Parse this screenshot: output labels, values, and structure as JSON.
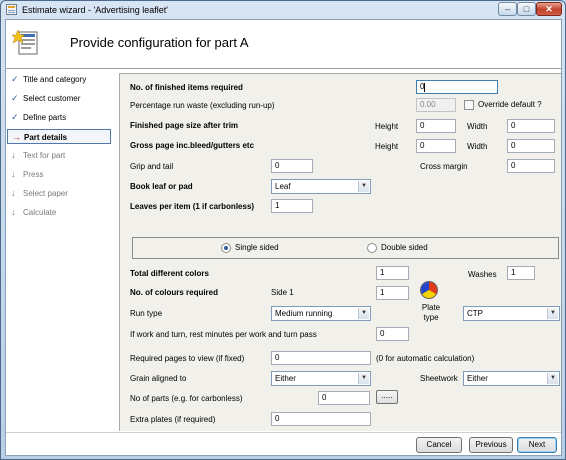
{
  "window": {
    "title": "Estimate wizard - 'Advertising leaflet'"
  },
  "titlebar": {
    "minimize": "–",
    "maximize": "□",
    "close": "✕"
  },
  "header": {
    "title": "Provide configuration for part A"
  },
  "steps": [
    {
      "label": "Title and category",
      "mark": "✓",
      "state": "done"
    },
    {
      "label": "Select customer",
      "mark": "✓",
      "state": "done"
    },
    {
      "label": "Define parts",
      "mark": "✓",
      "state": "done"
    },
    {
      "label": "Part details",
      "mark": "→",
      "state": "current"
    },
    {
      "label": "Text for part",
      "mark": "↓",
      "state": "pending"
    },
    {
      "label": "Press",
      "mark": "↓",
      "state": "pending"
    },
    {
      "label": "Select paper",
      "mark": "↓",
      "state": "pending"
    },
    {
      "label": "Calculate",
      "mark": "↓",
      "state": "pending"
    }
  ],
  "form": {
    "finished_items": {
      "label": "No. of finished items required",
      "value": "0"
    },
    "run_waste": {
      "label": "Percentage run waste (excluding run-up)",
      "value": "0.00"
    },
    "override": {
      "label": "Override default ?"
    },
    "finished_size": {
      "label": "Finished page size after trim",
      "height_label": "Height",
      "height": "0",
      "width_label": "Width",
      "width": "0"
    },
    "gross_size": {
      "label": "Gross page inc.bleed/gutters etc",
      "height_label": "Height",
      "height": "0",
      "width_label": "Width",
      "width": "0"
    },
    "grip_tail": {
      "label": "Grip and tail",
      "value": "0"
    },
    "cross_margin": {
      "label": "Cross margin",
      "value": "0"
    },
    "book_leaf": {
      "label": "Book leaf or pad",
      "value": "Leaf"
    },
    "leaves_per_item": {
      "label": "Leaves per item (1 if carbonless)",
      "value": "1"
    },
    "sides": {
      "single": "Single sided",
      "double": "Double sided"
    },
    "total_colors": {
      "label": "Total different colors",
      "value": "1"
    },
    "washes": {
      "label": "Washes",
      "value": "1"
    },
    "colours_required": {
      "label": "No. of colours required",
      "side_label": "Side 1",
      "value": "1"
    },
    "plate_type": {
      "label": "Plate type",
      "value": "CTP"
    },
    "run_type": {
      "label": "Run type",
      "value": "Medium running"
    },
    "work_turn": {
      "label": "If work and turn, rest minutes per work and turn pass",
      "value": "0"
    },
    "required_pages": {
      "label": "Required pages to view (if fixed)",
      "value": "0",
      "hint": "(0 for automatic calculation)"
    },
    "grain": {
      "label": "Grain aligned to",
      "value": "Either"
    },
    "sheetwork": {
      "label": "Sheetwork",
      "value": "Either"
    },
    "num_parts": {
      "label": "No of parts (e.g. for carbonless)",
      "value": "0",
      "button": "....."
    },
    "extra_plates": {
      "label": "Extra plates (if required)",
      "value": "0"
    }
  },
  "buttons": {
    "cancel": "Cancel",
    "previous": "Previous",
    "next": "Next"
  },
  "colors": {
    "accent": "#3c7fb1",
    "panel_bg": "#f1f0ea",
    "plate_red": "#e03c1c",
    "plate_yellow": "#f4d400",
    "plate_blue": "#2448c8"
  }
}
